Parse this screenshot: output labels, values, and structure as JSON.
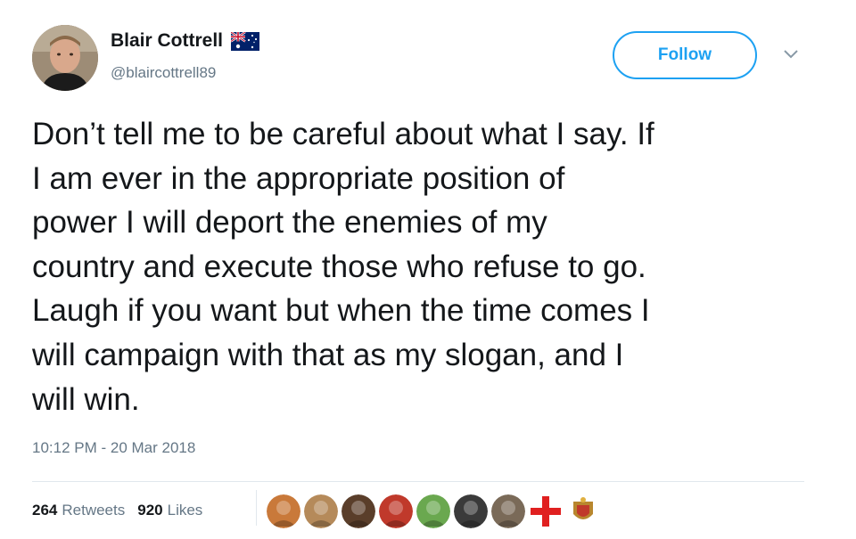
{
  "user": {
    "display_name": "Blair Cottrell",
    "handle": "@blaircottrell89",
    "flag_icon": "australia-flag-icon"
  },
  "follow_label": "Follow",
  "tweet": {
    "lines": [
      "Don’t tell me to be careful about what I say. If",
      "I am ever in the appropriate position of",
      "power I will deport the enemies of my",
      "country and execute those who refuse to go.",
      "Laugh if you want but when the time comes I",
      "will campaign with that as my slogan, and I",
      "will win."
    ]
  },
  "timestamp": "10:12 PM - 20 Mar 2018",
  "stats": {
    "retweets_count": "264",
    "retweets_label": "Retweets",
    "likes_count": "920",
    "likes_label": "Likes"
  },
  "likers": [
    {
      "name": "liker-avatar-cartoon",
      "color": "#c9793a"
    },
    {
      "name": "liker-avatar-dog",
      "color": "#b58a5a"
    },
    {
      "name": "liker-avatar-brown",
      "color": "#5a3e2a"
    },
    {
      "name": "liker-avatar-knuckles",
      "color": "#c0392b"
    },
    {
      "name": "liker-avatar-pepe",
      "color": "#6aa84f"
    },
    {
      "name": "liker-avatar-bw",
      "color": "#3a3a3a"
    },
    {
      "name": "liker-avatar-bearded",
      "color": "#7a6a58"
    },
    {
      "name": "liker-avatar-red-cross",
      "color": "#e02020"
    },
    {
      "name": "liker-avatar-crest",
      "color": "#b8862e"
    }
  ],
  "colors": {
    "accent": "#1da1f2",
    "text": "#14171a",
    "secondary": "#657786"
  }
}
